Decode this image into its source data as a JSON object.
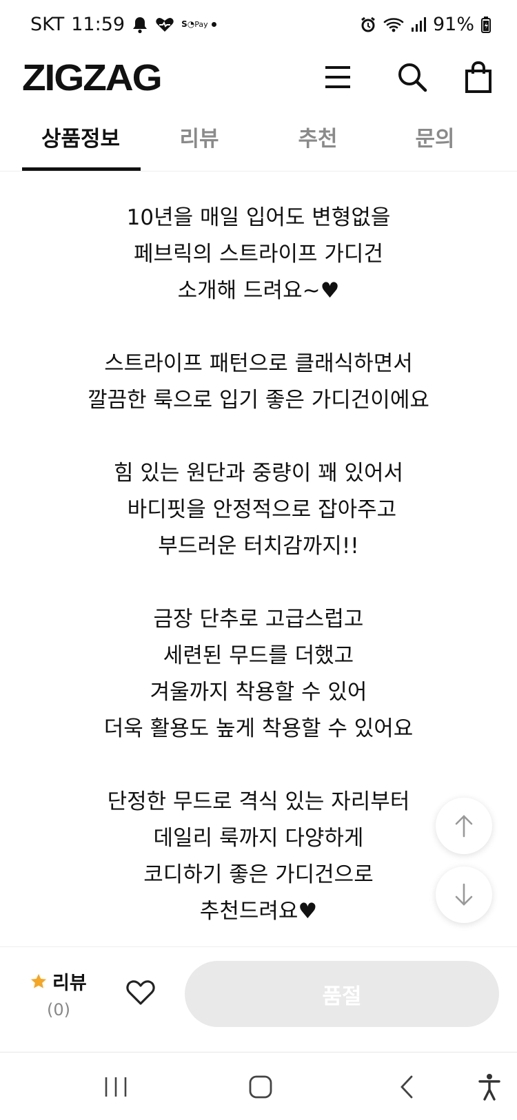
{
  "status_bar": {
    "carrier": "SKT",
    "time": "11:59",
    "pay_label": "Pay",
    "battery": "91%",
    "icons": [
      "bell-icon",
      "heart-link-icon",
      "pay-icon",
      "alarm-icon",
      "wifi-icon",
      "signal-icon",
      "battery-icon"
    ]
  },
  "header": {
    "logo": "ZIGZAG",
    "icons": [
      "menu-icon",
      "search-icon",
      "shopping-bag-icon"
    ]
  },
  "tabs": [
    {
      "label": "상품정보",
      "active": true
    },
    {
      "label": "리뷰",
      "active": false
    },
    {
      "label": "추천",
      "active": false
    },
    {
      "label": "문의",
      "active": false
    }
  ],
  "content": {
    "paragraphs": [
      [
        "10년을 매일 입어도 변형없을",
        "페브릭의 스트라이프 가디건",
        "소개해 드려요~♥"
      ],
      [
        "스트라이프 패턴으로 클래식하면서",
        "깔끔한 룩으로 입기 좋은 가디건이에요"
      ],
      [
        "힘 있는 원단과 중량이 꽤 있어서",
        " 바디핏을 안정적으로 잡아주고",
        "부드러운 터치감까지!!"
      ],
      [
        "금장 단추로 고급스럽고",
        "세련된 무드를 더했고",
        "겨울까지 착용할 수 있어",
        "더욱 활용도 높게 착용할 수 있어요"
      ],
      [
        "단정한 무드로 격식 있는 자리부터",
        "데일리 룩까지 다양하게",
        "코디하기 좋은 가디건으로",
        "추천드려요♥"
      ]
    ]
  },
  "floating": {
    "up_icon": "arrow-up-icon",
    "down_icon": "arrow-down-icon"
  },
  "action_bar": {
    "review_label": "리뷰",
    "review_count": "(0)",
    "star_color": "#f5a623",
    "soldout_label": "품절",
    "soldout_bg": "#e9e9e9"
  },
  "nav_bar": {
    "icons": [
      "recent-apps-icon",
      "home-icon",
      "back-icon",
      "accessibility-icon"
    ]
  }
}
